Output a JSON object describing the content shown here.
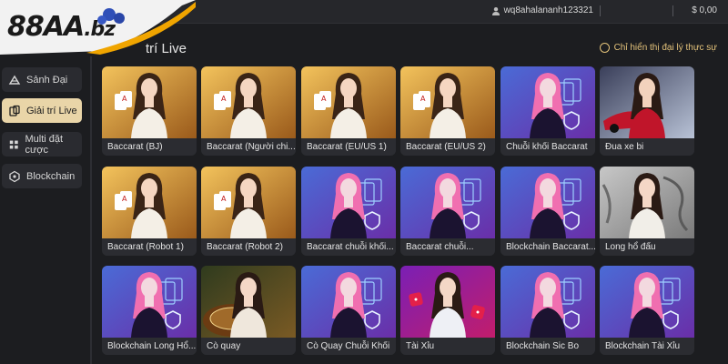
{
  "brand": {
    "logo": "88AA",
    "logo_suffix": ".bz",
    "accent": "#e9d5a8",
    "logo_bg": "#f2f2f2",
    "swoosh": "#f0a500"
  },
  "header": {
    "username": "wq8ahalananh123321",
    "balance": "$ 0,00",
    "user_icon": "user-icon"
  },
  "section": {
    "title": "Giải trí Live",
    "title_visible": "trí Live",
    "filter_label": "Chỉ hiển thị đại lý thực sự"
  },
  "sidebar": {
    "items": [
      {
        "label": "Sảnh Đại",
        "icon": "lobby-icon",
        "active": false
      },
      {
        "label": "Giải trí Live",
        "icon": "cards-icon",
        "active": true
      },
      {
        "label": "Multi đặt cược",
        "icon": "grid-icon",
        "active": false
      },
      {
        "label": "Blockchain",
        "icon": "blockchain-icon",
        "active": false
      }
    ]
  },
  "games": [
    {
      "label": "Baccarat (BJ)",
      "theme": "gold-dealer"
    },
    {
      "label": "Baccarat (Người chi...",
      "theme": "gold-dealer"
    },
    {
      "label": "Baccarat (EU/US 1)",
      "theme": "gold-dealer"
    },
    {
      "label": "Baccarat (EU/US 2)",
      "theme": "gold-dealer"
    },
    {
      "label": "Chuỗi khối Baccarat",
      "theme": "purple-avatar"
    },
    {
      "label": "Đua xe bi",
      "theme": "race"
    },
    {
      "label": "Baccarat (Robot 1)",
      "theme": "gold-dealer"
    },
    {
      "label": "Baccarat (Robot 2)",
      "theme": "gold-dealer"
    },
    {
      "label": "Baccarat chuỗi khối...",
      "theme": "purple-avatar"
    },
    {
      "label": "Baccarat chuỗi...",
      "theme": "purple-avatar"
    },
    {
      "label": "Blockchain Baccarat...",
      "theme": "purple-avatar"
    },
    {
      "label": "Long hổ đấu",
      "theme": "dragon"
    },
    {
      "label": "Blockchain Long Hổ...",
      "theme": "purple-avatar"
    },
    {
      "label": "Cò quay",
      "theme": "roulette"
    },
    {
      "label": "Cò Quay Chuỗi Khối",
      "theme": "purple-avatar"
    },
    {
      "label": "Tài Xỉu",
      "theme": "dice"
    },
    {
      "label": "Blockchain Sic Bo",
      "theme": "purple-avatar"
    },
    {
      "label": "Blockchain Tài Xỉu",
      "theme": "purple-avatar"
    }
  ]
}
